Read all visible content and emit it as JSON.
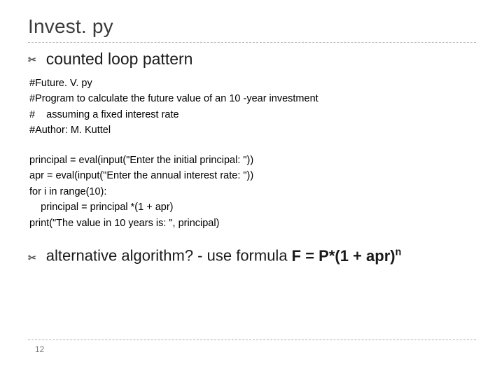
{
  "title": "Invest. py",
  "bullet1": "counted loop pattern",
  "code": {
    "l1": "#Future. V. py",
    "l2": "#Program to calculate the future value of an 10 -year investment",
    "l3": "#    assuming a fixed interest rate",
    "l4": "#Author: M. Kuttel",
    "l5": "principal = eval(input(\"Enter the initial principal: \"))",
    "l6": "apr = eval(input(\"Enter the annual interest rate: \"))",
    "l7": "for i in range(10):",
    "l8": "    principal = principal *(1 + apr)",
    "l9": "print(\"The value in 10 years is: \", principal)"
  },
  "alt_prefix": "alternative algorithm?  - use formula  ",
  "alt_formula_base": "F = P*(1 + apr)",
  "alt_formula_exp": "n",
  "page": "12"
}
